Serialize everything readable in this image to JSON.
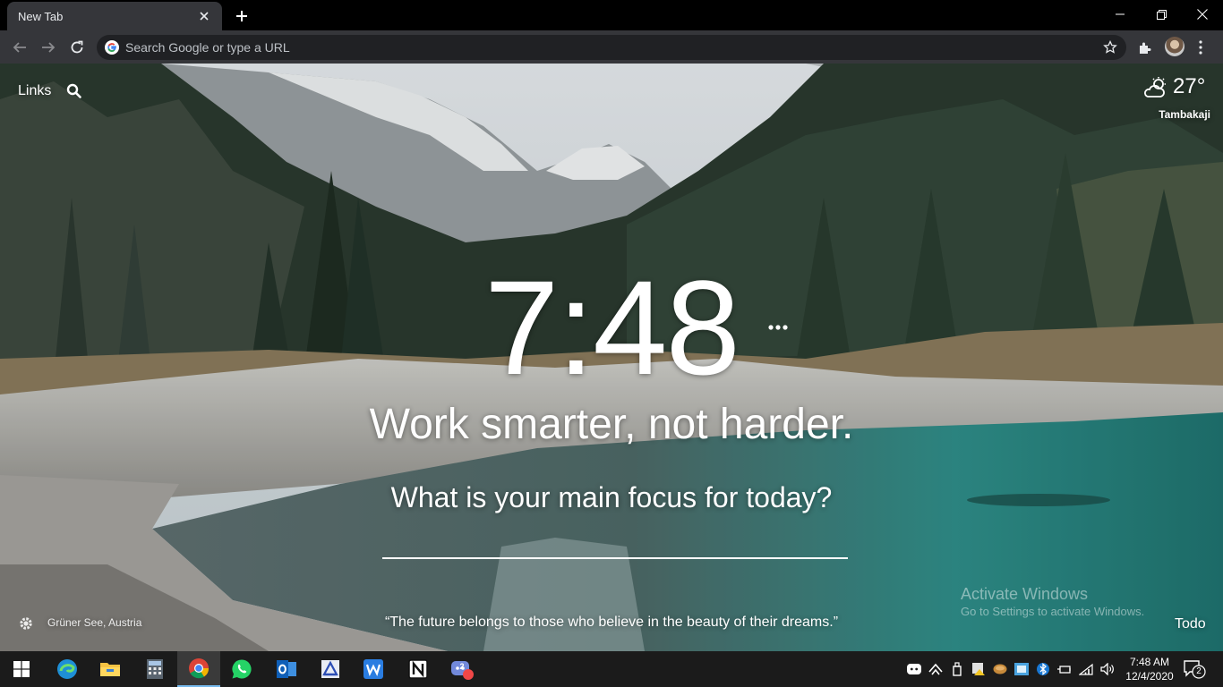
{
  "browser": {
    "tab_title": "New Tab",
    "omnibox_placeholder": "Search Google or type a URL"
  },
  "newtab": {
    "links_label": "Links",
    "weather": {
      "temperature": "27°",
      "location": "Tambakaji",
      "icon": "partly-cloudy-icon"
    },
    "clock": "7:48",
    "greeting": "Work smarter, not harder.",
    "focus_question": "What is your main focus for today?",
    "photo_location": "Grüner See, Austria",
    "quote": "“The future belongs to those who believe in the beauty of their dreams.”",
    "todo_label": "Todo"
  },
  "activation": {
    "title": "Activate Windows",
    "subtitle": "Go to Settings to activate Windows."
  },
  "taskbar": {
    "apps": [
      "windows-start",
      "edge",
      "file-explorer",
      "calculator",
      "chrome",
      "whatsapp",
      "outlook",
      "azure-dev-tool",
      "wps-writer",
      "notion",
      "discord"
    ],
    "discord_badge": "2",
    "time": "7:48 AM",
    "date": "12/4/2020",
    "notification_count": "2"
  },
  "colors": {
    "chrome_titlebar": "#000000",
    "chrome_toolbar": "#35363a",
    "omnibox": "#202124",
    "taskbar": "#1b1b1b",
    "taskbar_active_underline": "#76b9ed",
    "lake_teal": "#2f8f8a"
  }
}
